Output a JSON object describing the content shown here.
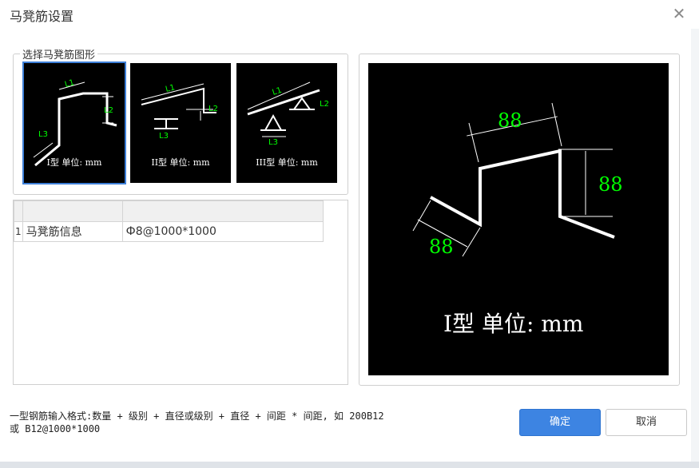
{
  "dialog": {
    "title": "马凳筋设置",
    "close_glyph": "✕"
  },
  "shape_group": {
    "legend": "选择马凳筋图形",
    "options": [
      {
        "caption": "I型 单位: mm",
        "selected": true,
        "labels": [
          "L1",
          "L2",
          "L3"
        ]
      },
      {
        "caption": "II型 单位: mm",
        "selected": false,
        "labels": [
          "L1",
          "L2",
          "L3"
        ]
      },
      {
        "caption": "III型 单位: mm",
        "selected": false,
        "labels": [
          "L1",
          "L2",
          "L3"
        ]
      }
    ]
  },
  "info_grid": {
    "headers": [
      "",
      ""
    ],
    "rows": [
      {
        "num": "1",
        "name": "马凳筋信息",
        "value": "Ф8@1000*1000"
      }
    ]
  },
  "preview": {
    "dim_top": "88",
    "dim_right": "88",
    "dim_left": "88",
    "caption": "I型 单位: mm",
    "line_color": "#ffffff",
    "dim_color": "#00ff00"
  },
  "hint": {
    "line1": "一型钢筋输入格式:数量 + 级别 + 直径或级别 + 直径 + 间距 * 间距, 如 200B12",
    "line2": "或 B12@1000*1000"
  },
  "buttons": {
    "ok": "确定",
    "cancel": "取消"
  },
  "colors": {
    "accent": "#3d84e2",
    "dim_green": "#00ff00"
  }
}
